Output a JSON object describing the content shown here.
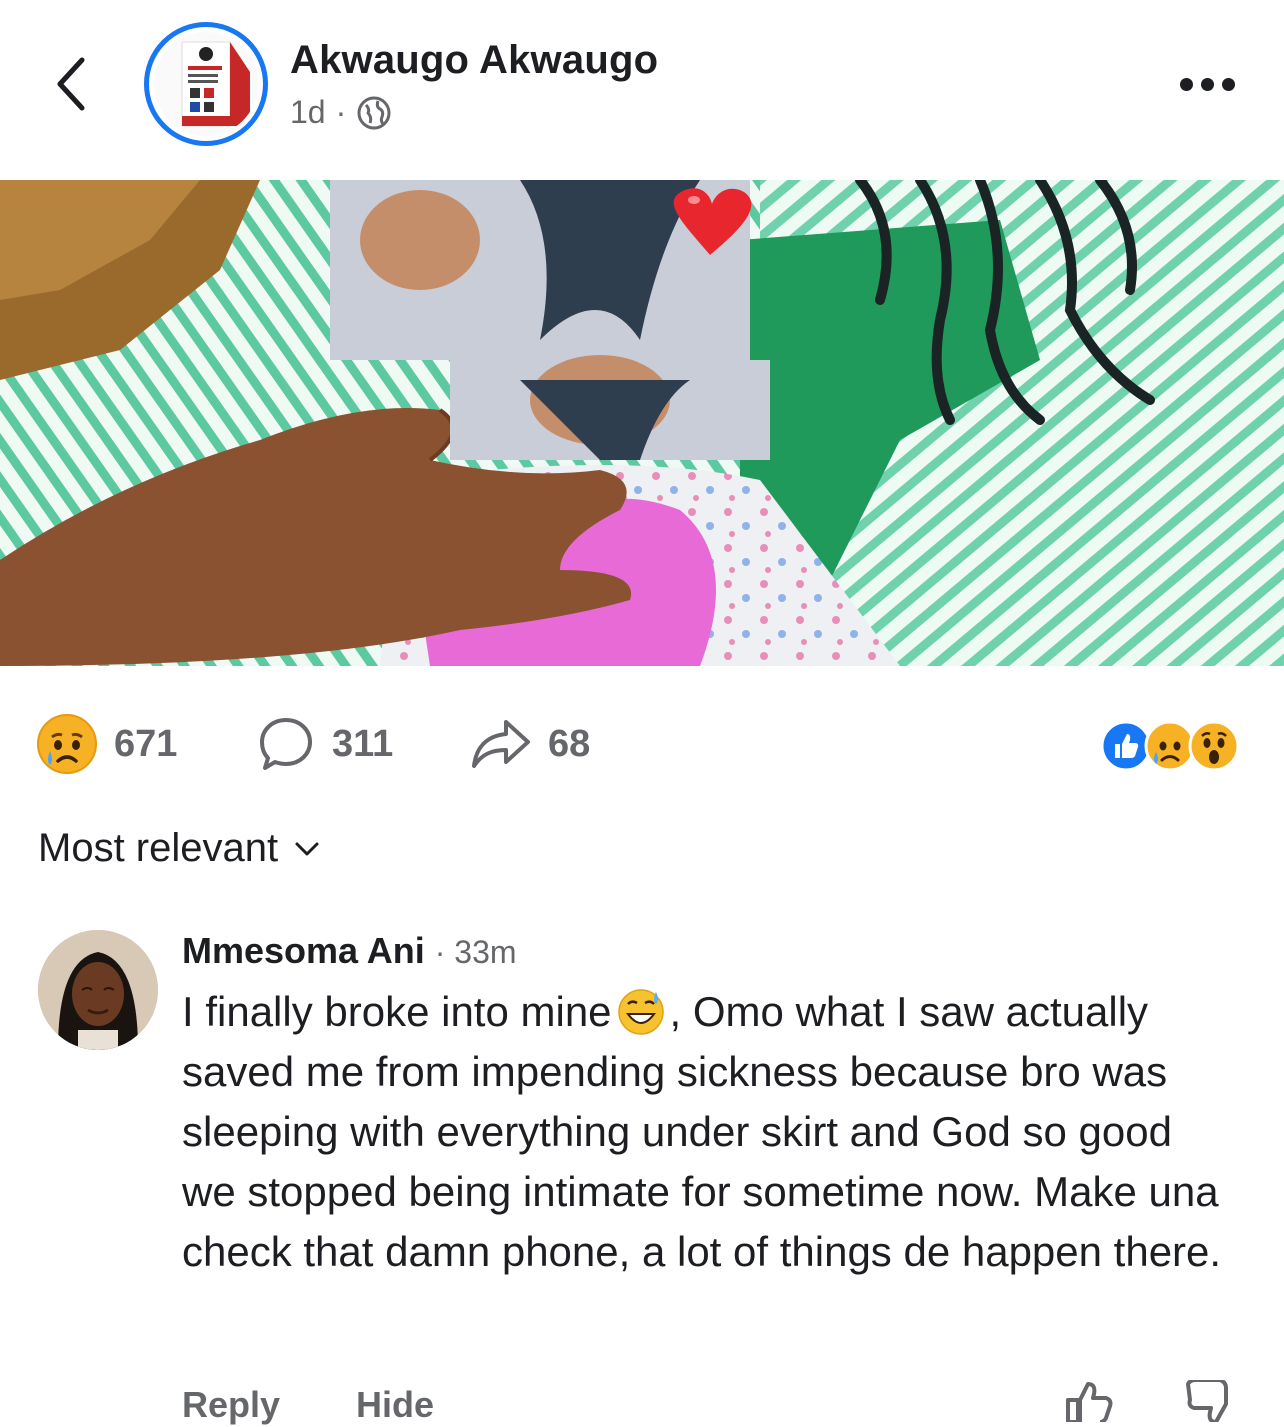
{
  "header": {
    "page_name": "Akwaugo Akwaugo",
    "time": "1d",
    "separator": "·",
    "icons": {
      "back": "chevron-left-icon",
      "privacy": "globe-icon",
      "more": "more-horizontal-icon"
    }
  },
  "post": {
    "photo_description": "Photo with a red heart sticker and blurred faces",
    "stats": {
      "reactions": "671",
      "comments": "311",
      "shares": "68"
    },
    "reaction_icons": [
      "like-icon",
      "sad-cry-icon",
      "wow-icon"
    ]
  },
  "sort": {
    "label": "Most relevant"
  },
  "comment": {
    "author": "Mmesoma Ani",
    "separator": "·",
    "time": "33m",
    "text_before_emoji": "I finally broke into mine",
    "text_after_emoji": ", Omo what I saw actually saved me from impending sickness because bro was sleeping with everything under skirt and God so good we stopped being intimate for sometime now. Make una check that damn phone, a lot of things de happen there.",
    "actions": {
      "reply": "Reply",
      "hide": "Hide"
    }
  },
  "colors": {
    "accent": "#1877f2",
    "muted": "#65676b",
    "text": "#1c1e21",
    "stripe_green": "#5cc9a0"
  }
}
